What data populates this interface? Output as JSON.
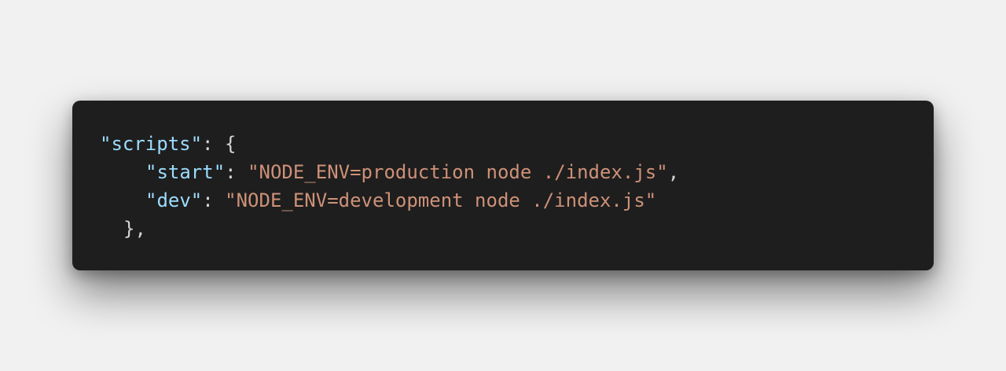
{
  "colors": {
    "background": "#f1f1f1",
    "editor_background": "#1e1e1e",
    "key": "#9cdcfe",
    "string": "#ce9178",
    "punctuation": "#d4d4d4"
  },
  "code": {
    "lines": [
      {
        "key": "\"scripts\"",
        "sep": ": ",
        "value": "",
        "tail": "{"
      },
      {
        "key": "\"start\"",
        "sep": ": ",
        "value": "\"NODE_ENV=production node ./index.js\"",
        "tail": ","
      },
      {
        "key": "\"dev\"",
        "sep": ": ",
        "value": "\"NODE_ENV=development node ./index.js\"",
        "tail": ""
      },
      {
        "key": "",
        "sep": "",
        "value": "",
        "tail": "},"
      }
    ]
  }
}
